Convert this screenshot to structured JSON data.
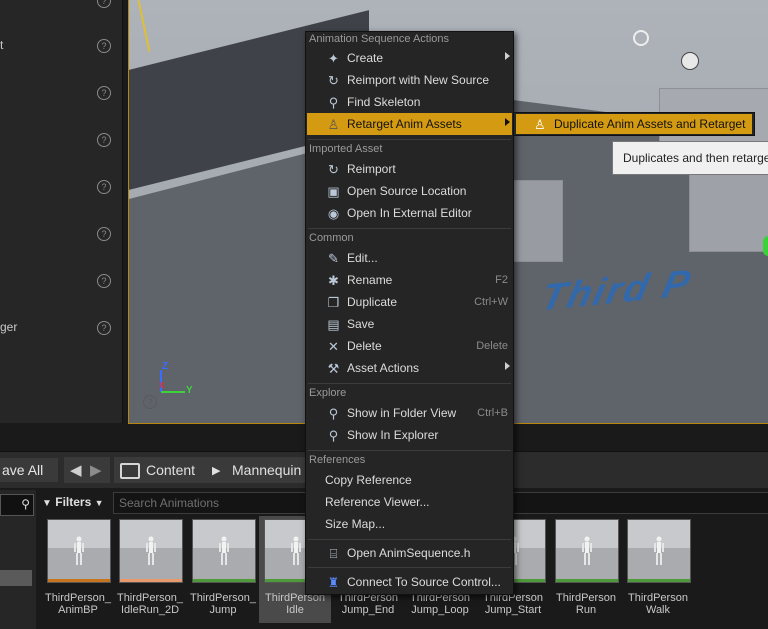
{
  "left_panel": {
    "fragments": [
      {
        "text": "t"
      },
      {
        "text": "ger"
      }
    ],
    "help_glyph": "?"
  },
  "viewport": {
    "overlay_text": "Third P",
    "axis": {
      "z": "Z",
      "y": "Y",
      "x": "X"
    },
    "help_glyph": "?"
  },
  "content_browser": {
    "save_all": "ave All",
    "breadcrumb": [
      "Content",
      "Mannequin"
    ],
    "filters_label": "Filters",
    "search_placeholder": "Search Animations",
    "assets": [
      {
        "label_line1": "ThirdPerson_",
        "label_line2": "AnimBP",
        "bar_color": "#c8741c"
      },
      {
        "label_line1": "ThirdPerson_",
        "label_line2": "IdleRun_2D",
        "bar_color": "#e89a6c"
      },
      {
        "label_line1": "ThirdPerson_",
        "label_line2": "Jump",
        "bar_color": "#4e9a3a"
      },
      {
        "label_line1": "ThirdPerson",
        "label_line2": "Idle",
        "bar_color": "#4e9a3a"
      },
      {
        "label_line1": "ThirdPerson",
        "label_line2": "Jump_End",
        "bar_color": "#4e9a3a"
      },
      {
        "label_line1": "ThirdPerson",
        "label_line2": "Jump_Loop",
        "bar_color": "#4e9a3a"
      },
      {
        "label_line1": "ThirdPerson",
        "label_line2": "Jump_Start",
        "bar_color": "#4e9a3a"
      },
      {
        "label_line1": "ThirdPerson",
        "label_line2": "Run",
        "bar_color": "#4e9a3a"
      },
      {
        "label_line1": "ThirdPerson",
        "label_line2": "Walk",
        "bar_color": "#4e9a3a"
      }
    ]
  },
  "context_menu": {
    "sections": {
      "anim_sequence_actions": "Animation Sequence Actions",
      "imported_asset": "Imported Asset",
      "common": "Common",
      "explore": "Explore",
      "references": "References"
    },
    "items": {
      "create": {
        "label": "Create",
        "icon": "create-icon"
      },
      "reimport_new_source": {
        "label": "Reimport with New Source",
        "icon": "reimport-icon"
      },
      "find_skeleton": {
        "label": "Find Skeleton",
        "icon": "magnifier-icon"
      },
      "retarget_anim_assets": {
        "label": "Retarget Anim Assets",
        "icon": "retarget-icon"
      },
      "reimport": {
        "label": "Reimport",
        "icon": "reimport-icon"
      },
      "open_source_location": {
        "label": "Open Source Location",
        "icon": "folder-icon"
      },
      "open_external_editor": {
        "label": "Open In External Editor",
        "icon": "external-editor-icon"
      },
      "edit": {
        "label": "Edit...",
        "icon": "pencil-icon"
      },
      "rename": {
        "label": "Rename",
        "shortcut": "F2",
        "icon": "rename-icon"
      },
      "duplicate": {
        "label": "Duplicate",
        "shortcut": "Ctrl+W",
        "icon": "duplicate-icon"
      },
      "save": {
        "label": "Save",
        "icon": "save-icon"
      },
      "delete": {
        "label": "Delete",
        "shortcut": "Delete",
        "icon": "delete-icon"
      },
      "asset_actions": {
        "label": "Asset Actions",
        "icon": "wrench-icon"
      },
      "show_in_folder_view": {
        "label": "Show in Folder View",
        "shortcut": "Ctrl+B",
        "icon": "magnifier-icon"
      },
      "show_in_explorer": {
        "label": "Show In Explorer",
        "icon": "magnifier-icon"
      },
      "copy_reference": {
        "label": "Copy Reference"
      },
      "reference_viewer": {
        "label": "Reference Viewer..."
      },
      "size_map": {
        "label": "Size Map..."
      },
      "open_anim_sequence_h": {
        "label": "Open AnimSequence.h",
        "icon": "code-file-icon"
      },
      "connect_source_control": {
        "label": "Connect To Source Control...",
        "icon": "source-control-icon"
      }
    }
  },
  "submenu": {
    "label": "Duplicate Anim Assets and Retarget",
    "icon": "retarget-icon"
  },
  "tooltip": {
    "text": "Duplicates and then retarge"
  },
  "colors": {
    "highlight": "#d49a12",
    "menu_bg": "#252525",
    "viewport_border": "#b8860b"
  }
}
